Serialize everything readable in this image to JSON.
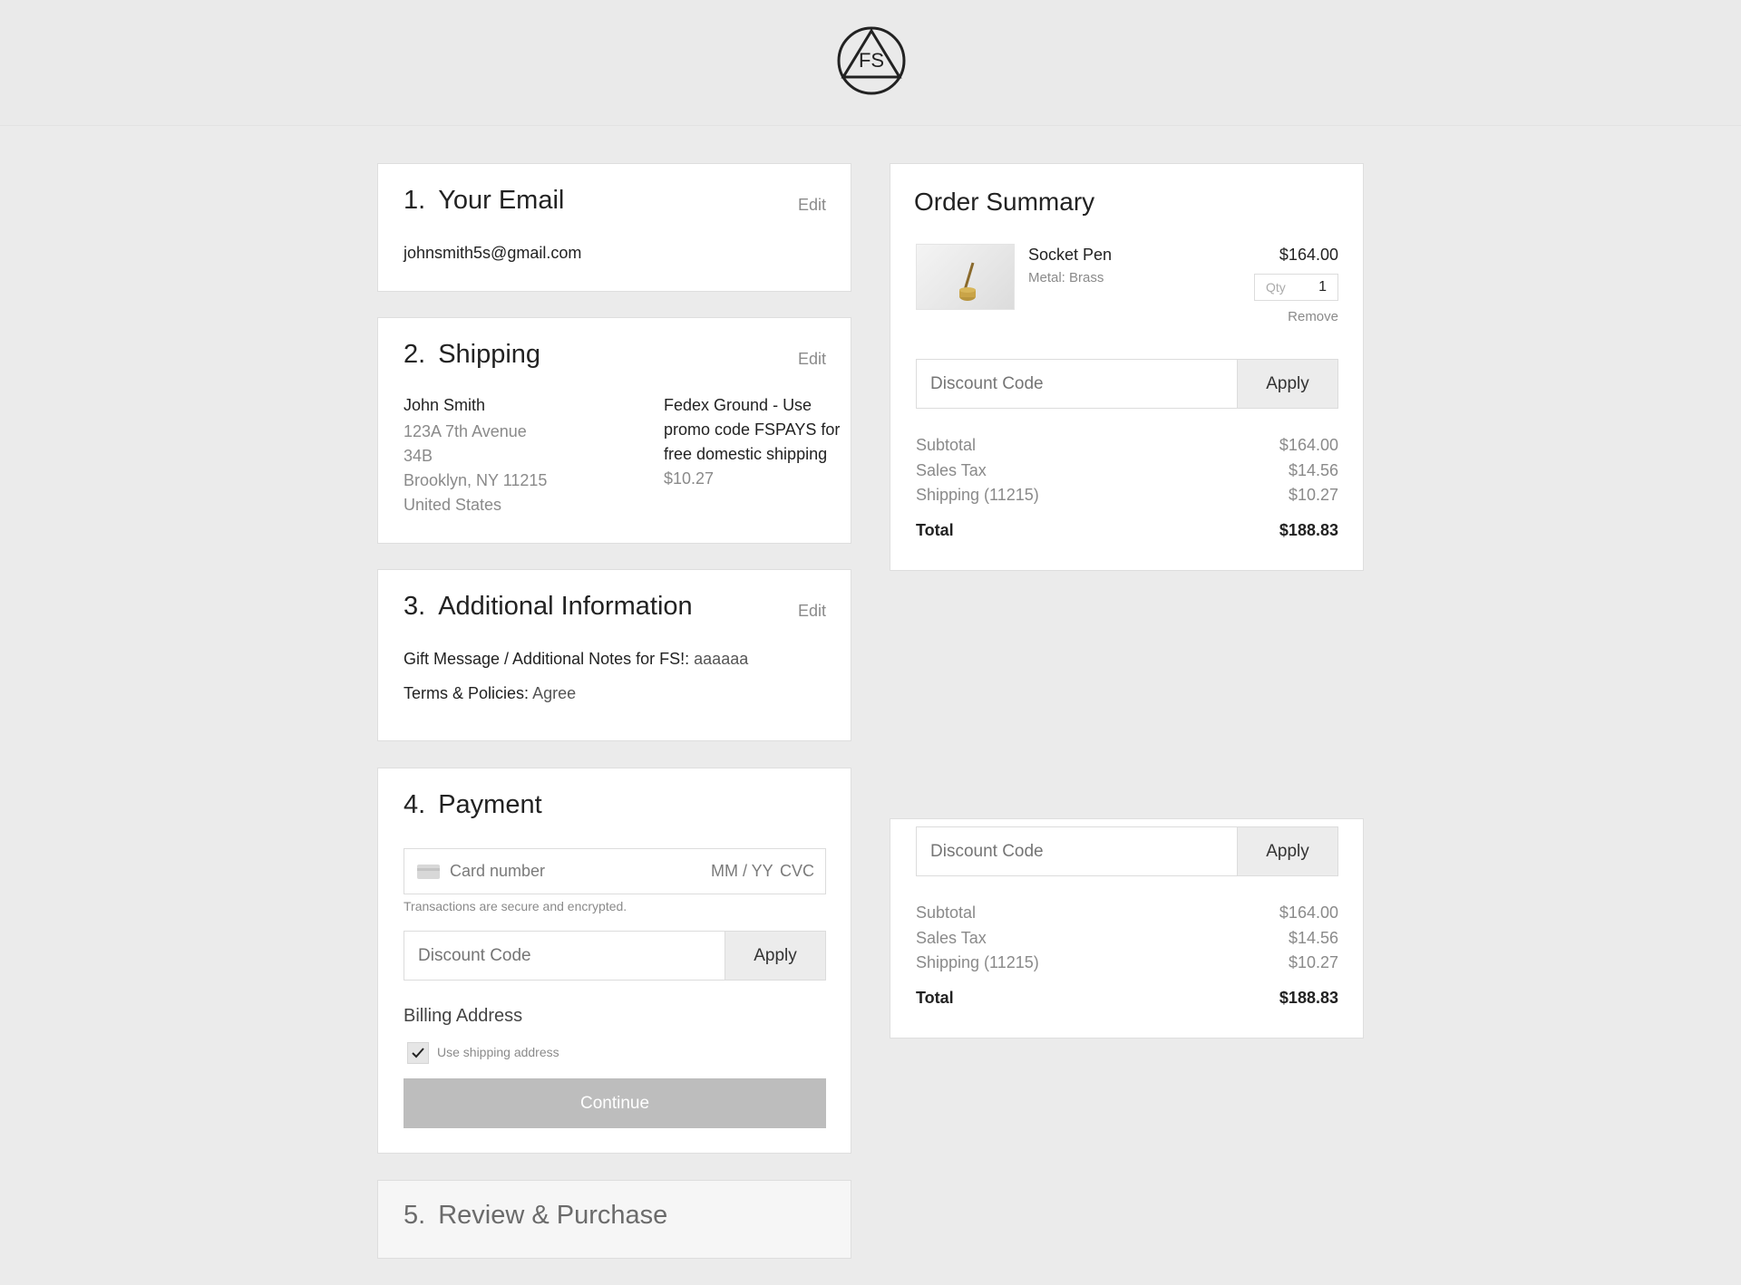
{
  "brand": {
    "logo_text": "FS"
  },
  "steps": {
    "email": {
      "number": "1.",
      "title": "Your Email",
      "edit_label": "Edit",
      "value": "johnsmith5s@gmail.com"
    },
    "shipping": {
      "number": "2.",
      "title": "Shipping",
      "edit_label": "Edit",
      "name": "John Smith",
      "address_lines": [
        "123A 7th Avenue",
        "34B",
        "Brooklyn, NY 11215",
        "United States"
      ],
      "method_lines": [
        "Fedex Ground - Use",
        "promo code FSPAYS for",
        "free domestic shipping"
      ],
      "method_price": "$10.27"
    },
    "additional": {
      "number": "3.",
      "title": "Additional Information",
      "edit_label": "Edit",
      "gift_label": "Gift Message / Additional Notes for FS!:",
      "gift_value": "aaaaaa",
      "terms_label": "Terms & Policies:",
      "terms_value": "Agree"
    },
    "payment": {
      "number": "4.",
      "title": "Payment",
      "card_placeholder": "Card number",
      "expiry_placeholder": "MM / YY",
      "cvc_placeholder": "CVC",
      "secure_note": "Transactions are secure and encrypted.",
      "discount_placeholder": "Discount Code",
      "apply_label": "Apply",
      "billing_heading": "Billing Address",
      "use_shipping_label": "Use shipping address",
      "use_shipping_checked": true,
      "continue_label": "Continue"
    },
    "review": {
      "number": "5.",
      "title": "Review & Purchase"
    }
  },
  "order_summary": {
    "title": "Order Summary",
    "item": {
      "name": "Socket Pen",
      "variant": "Metal: Brass",
      "price": "$164.00",
      "qty_label": "Qty",
      "qty_value": "1",
      "remove_label": "Remove"
    },
    "discount_placeholder": "Discount Code",
    "apply_label": "Apply",
    "subtotal_label": "Subtotal",
    "subtotal_value": "$164.00",
    "tax_label": "Sales Tax",
    "tax_value": "$14.56",
    "shipping_label": "Shipping (11215)",
    "shipping_value": "$10.27",
    "total_label": "Total",
    "total_value": "$188.83"
  },
  "summary_lower": {
    "discount_placeholder": "Discount Code",
    "apply_label": "Apply",
    "subtotal_label": "Subtotal",
    "subtotal_value": "$164.00",
    "tax_label": "Sales Tax",
    "tax_value": "$14.56",
    "shipping_label": "Shipping (11215)",
    "shipping_value": "$10.27",
    "total_label": "Total",
    "total_value": "$188.83"
  }
}
